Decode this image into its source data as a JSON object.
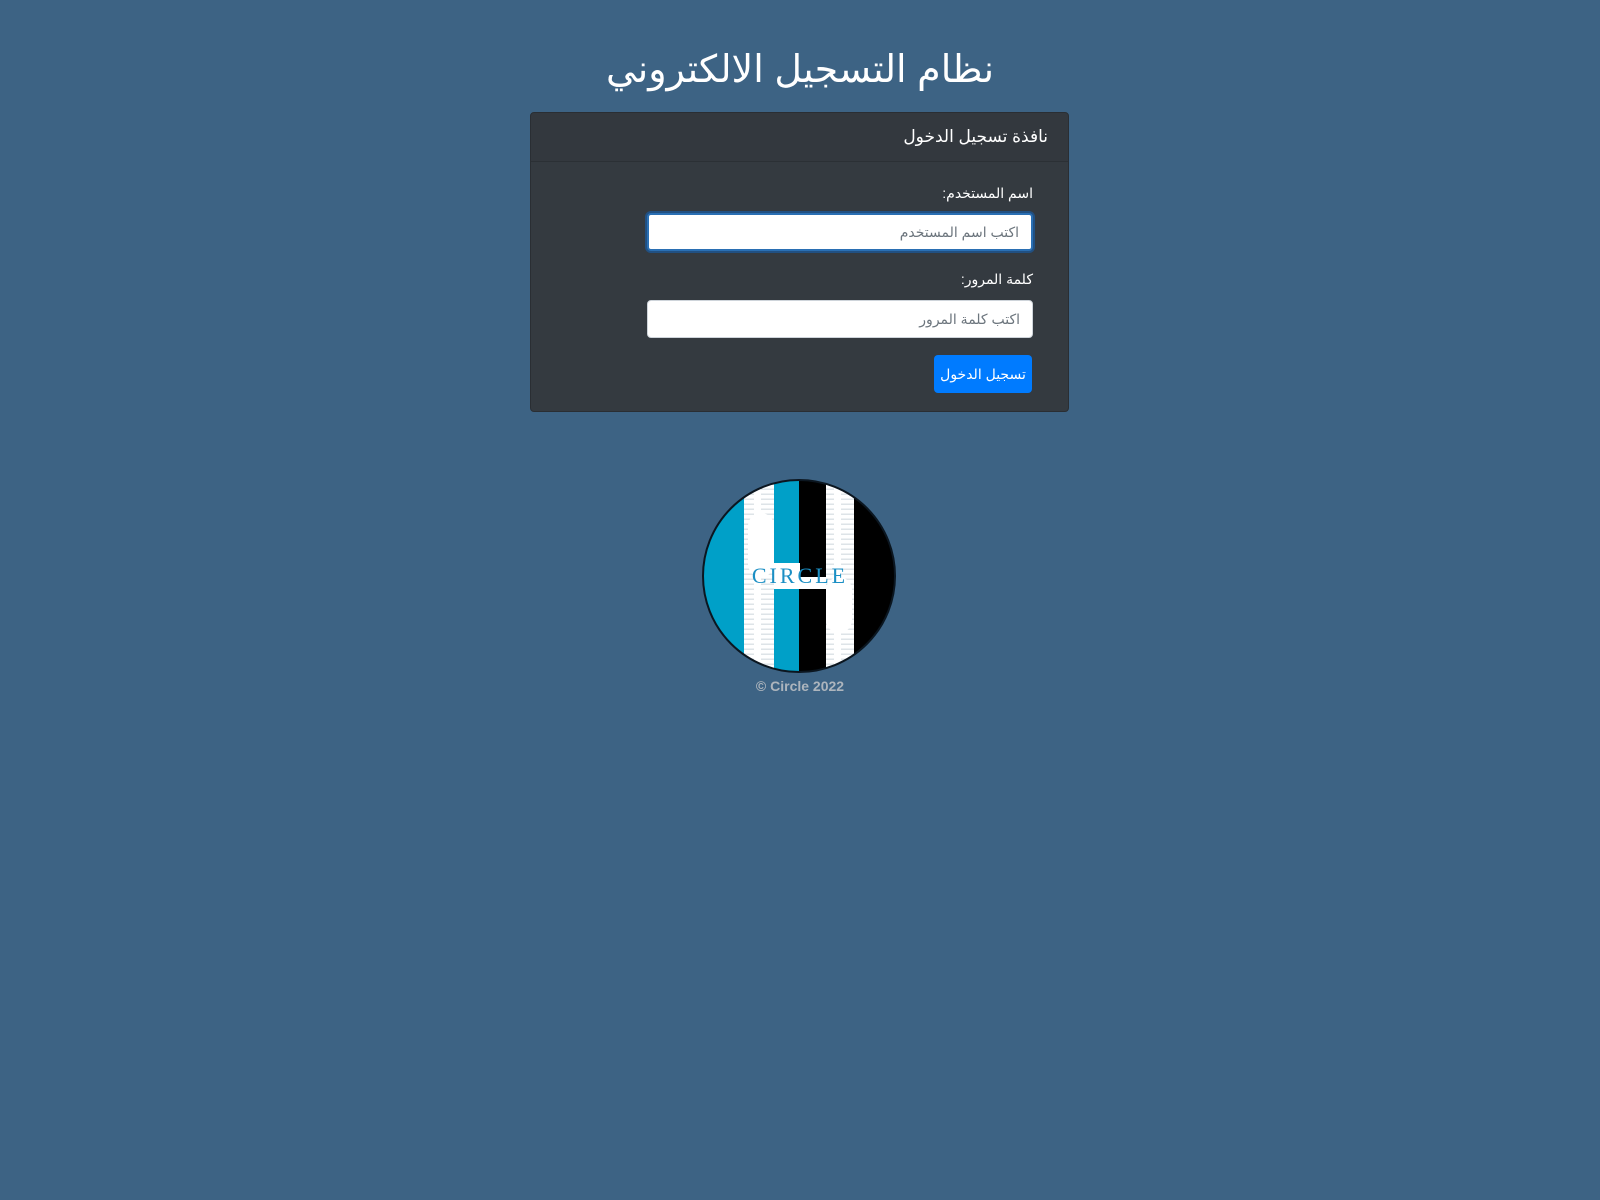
{
  "header": {
    "title": "نظام التسجيل الالكتروني"
  },
  "login": {
    "card_title": "نافذة تسجيل الدخول",
    "username_label": "اسم المستخدم:",
    "username_placeholder": "اكتب اسم المستخدم",
    "username_value": "",
    "password_label": "كلمة المرور:",
    "password_placeholder": "اكتب كلمة المرور",
    "password_value": "",
    "submit_label": "تسجيل الدخول"
  },
  "logo": {
    "text": "CIRCLE",
    "icon": "circle-h-logo",
    "colors": {
      "blue": "#00a0c8",
      "black": "#000000",
      "white": "#ffffff"
    }
  },
  "footer": {
    "copyright": "© Circle 2022"
  },
  "theme": {
    "background": "#3d6384",
    "card": "#343a40",
    "primary": "#007bff"
  }
}
